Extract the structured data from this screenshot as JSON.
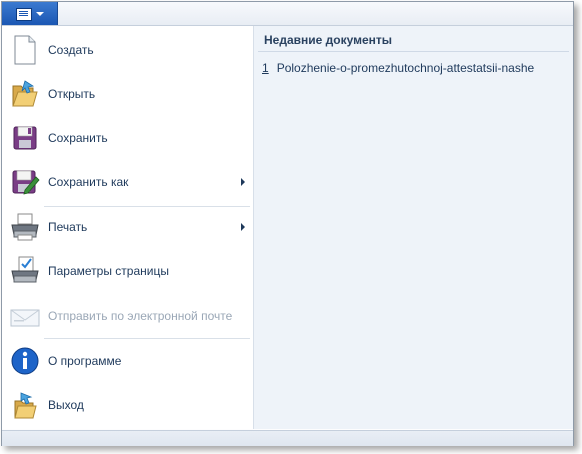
{
  "app_button": {
    "icon": "document-icon",
    "dropdown_icon": "chevron-down-icon"
  },
  "menu": {
    "items": [
      {
        "label": "Создать",
        "icon": "new-document-icon",
        "submenu": false,
        "enabled": true
      },
      {
        "label": "Открыть",
        "icon": "open-folder-icon",
        "submenu": false,
        "enabled": true
      },
      {
        "label": "Сохранить",
        "icon": "save-icon",
        "submenu": false,
        "enabled": true
      },
      {
        "label": "Сохранить как",
        "icon": "save-as-icon",
        "submenu": true,
        "enabled": true
      },
      {
        "label": "Печать",
        "icon": "printer-icon",
        "submenu": true,
        "enabled": true
      },
      {
        "label": "Параметры страницы",
        "icon": "page-setup-icon",
        "submenu": false,
        "enabled": true
      },
      {
        "label": "Отправить по электронной почте",
        "icon": "email-icon",
        "submenu": false,
        "enabled": false
      },
      {
        "label": "О программе",
        "icon": "info-icon",
        "submenu": false,
        "enabled": true
      },
      {
        "label": "Выход",
        "icon": "exit-icon",
        "submenu": false,
        "enabled": true
      }
    ]
  },
  "recent": {
    "title": "Недавние документы",
    "items": [
      {
        "number": "1",
        "name": "Polozhenie-o-promezhutochnoj-attestatsii-nashe"
      }
    ]
  },
  "colors": {
    "accent": "#1b57b3",
    "text": "#1e395b",
    "disabled_text": "#9aa7b6",
    "pane_bg": "#eef3f9"
  }
}
